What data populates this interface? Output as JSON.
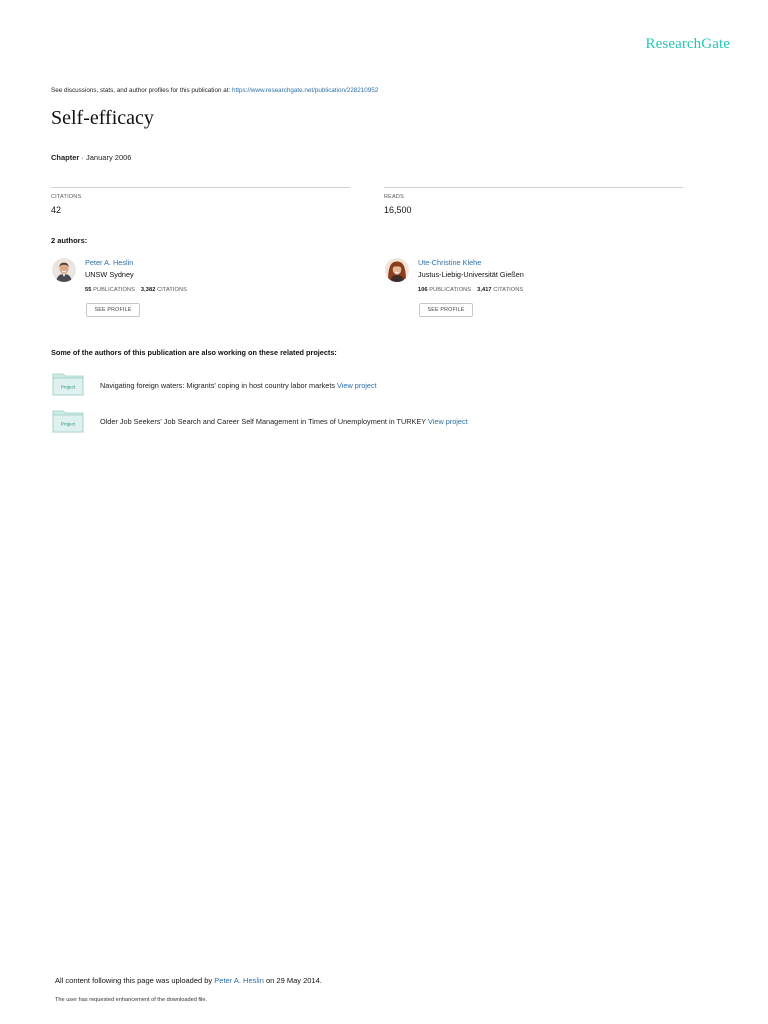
{
  "brand": {
    "logo_text": "ResearchGate",
    "accent_color": "#26c6b3",
    "link_color": "#2d6fa8"
  },
  "header": {
    "discussion_prefix": "See discussions, stats, and author profiles for this publication at: ",
    "publication_url": "https://www.researchgate.net/publication/228210952"
  },
  "publication": {
    "title": "Self-efficacy",
    "type": "Chapter",
    "separator": " · ",
    "date": "January 2006"
  },
  "stats": {
    "citations_label": "CITATIONS",
    "citations_value": "42",
    "reads_label": "READS",
    "reads_value": "16,500"
  },
  "authors": {
    "heading": "2 authors:",
    "items": [
      {
        "name": "Peter A. Heslin",
        "affiliation": "UNSW Sydney",
        "publications_count": "55",
        "publications_label": "PUBLICATIONS",
        "citations_count": "3,382",
        "citations_label": "CITATIONS",
        "button_label": "SEE PROFILE"
      },
      {
        "name": "Ute-Christine Klehe",
        "affiliation": "Justus-Liebig-Universität Gießen",
        "publications_count": "106",
        "publications_label": "PUBLICATIONS",
        "citations_count": "3,417",
        "citations_label": "CITATIONS",
        "button_label": "SEE PROFILE"
      }
    ]
  },
  "projects": {
    "heading": "Some of the authors of this publication are also working on these related projects:",
    "icon_label": "Project",
    "items": [
      {
        "text": "Navigating foreign waters: Migrants' coping in host country labor markets ",
        "link": "View project"
      },
      {
        "text": "Older Job Seekers' Job Search and Career Self Management in Times of Unemployment in TURKEY ",
        "link": "View project"
      }
    ]
  },
  "footer": {
    "upload_prefix": "All content following this page was uploaded by ",
    "uploader": "Peter A. Heslin",
    "upload_suffix": " on 29 May 2014.",
    "enhancement_note": "The user has requested enhancement of the downloaded file."
  }
}
